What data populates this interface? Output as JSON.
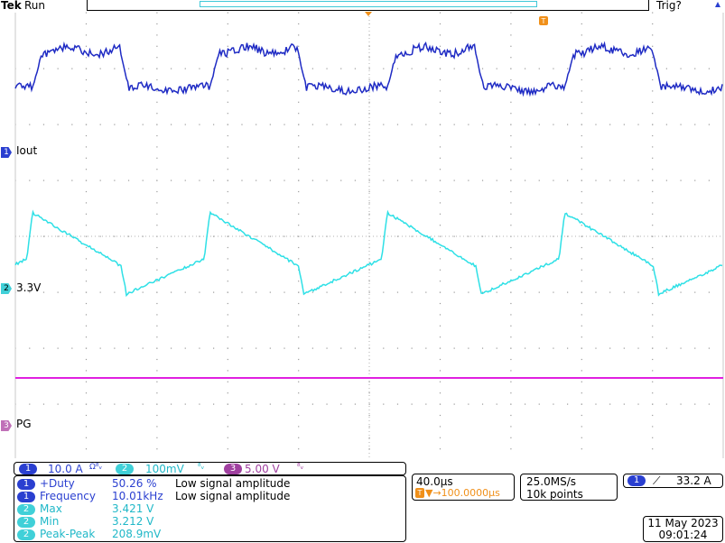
{
  "header": {
    "brand": "Tek",
    "status": "Run",
    "trigger_status": "Trig?"
  },
  "channels": {
    "ch1": {
      "number": "1",
      "name": "Iout",
      "color": "#2a3fd0"
    },
    "ch2": {
      "number": "2",
      "name": "3.3V",
      "color": "#40d0d8"
    },
    "ch3": {
      "number": "3",
      "name": "PG",
      "color": "#c070b8"
    }
  },
  "trace_colors": {
    "ch1": "#1f2bc4",
    "ch2": "#2ee0e6",
    "ch3": "#e020e0",
    "trigger": "#f0901a",
    "grid": "#9a9a9a"
  },
  "scales": {
    "ch1": {
      "num": "1",
      "value": "10.0 A",
      "coupling": "Ω⁸ᵥ"
    },
    "ch2": {
      "num": "2",
      "value": "100mV",
      "coupling": "⁸ᵥ"
    },
    "ch3": {
      "num": "3",
      "value": "5.00 V",
      "coupling": "⁸ᵥ"
    }
  },
  "measurements": [
    {
      "ch": "1",
      "name": "+Duty",
      "value": "50.26 %",
      "note": "Low signal amplitude"
    },
    {
      "ch": "1",
      "name": "Frequency",
      "value": "10.01kHz",
      "note": "Low signal amplitude"
    },
    {
      "ch": "2",
      "name": "Max",
      "value": "3.421 V",
      "note": ""
    },
    {
      "ch": "2",
      "name": "Min",
      "value": "3.212 V",
      "note": ""
    },
    {
      "ch": "2",
      "name": "Peak-Peak",
      "value": "208.9mV",
      "note": ""
    }
  ],
  "timebase": {
    "scale": "40.0µs",
    "trigger_pos": "▼→100.0000µs"
  },
  "acquisition": {
    "rate": "25.0MS/s",
    "points": "10k points"
  },
  "trigger": {
    "ch": "1",
    "slope": "⟋",
    "level": "33.2 A"
  },
  "datetime": {
    "date": "11 May 2023",
    "time": "09:01:24"
  }
}
